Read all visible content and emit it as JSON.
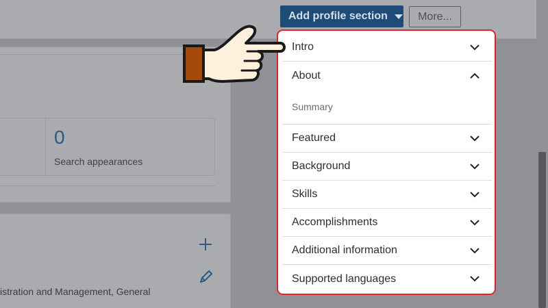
{
  "header": {
    "add_section_label": "Add profile section",
    "more_label": "More..."
  },
  "stats": {
    "search_count": "0",
    "search_label": "Search appearances"
  },
  "background_text": "istration and Management, General",
  "dropdown": {
    "items": [
      {
        "label": "Intro",
        "state": "collapsed"
      },
      {
        "label": "About",
        "state": "expanded",
        "children": [
          "Summary"
        ]
      },
      {
        "label": "Featured",
        "state": "collapsed"
      },
      {
        "label": "Background",
        "state": "collapsed"
      },
      {
        "label": "Skills",
        "state": "collapsed"
      },
      {
        "label": "Accomplishments",
        "state": "collapsed"
      },
      {
        "label": "Additional information",
        "state": "collapsed"
      },
      {
        "label": "Supported languages",
        "state": "collapsed"
      }
    ]
  },
  "colors": {
    "accent": "#1c4c77",
    "highlight_border": "#e0232a",
    "hand_fill": "#fdf0dc",
    "cuff": "#a54a08"
  }
}
